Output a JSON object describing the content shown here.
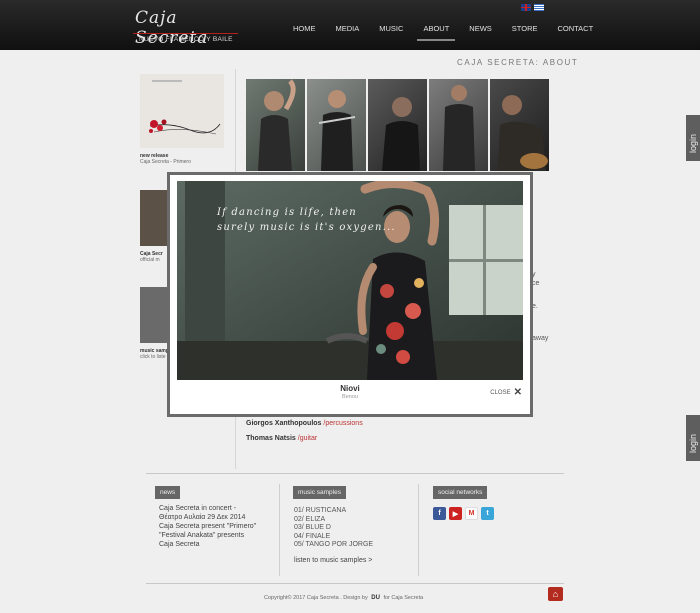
{
  "header": {
    "logo_text": "Caja Secreta",
    "logo_tagline": "NUEVO FLAMENCO Y BAILE",
    "nav": [
      {
        "label": "HOME"
      },
      {
        "label": "MEDIA"
      },
      {
        "label": "MUSIC"
      },
      {
        "label": "ABOUT"
      },
      {
        "label": "NEWS"
      },
      {
        "label": "STORE"
      },
      {
        "label": "CONTACT"
      }
    ]
  },
  "page_heading": "CAJA SECRETA: ABOUT",
  "sidebar": {
    "cards": [
      {
        "title": "new release",
        "subtitle": "Caja Secreta - Primero"
      },
      {
        "title": "Caja Secr",
        "subtitle": "official m"
      },
      {
        "title": "music samp",
        "subtitle": "click to liste"
      }
    ]
  },
  "body_fragments": {
    "f1": "y",
    "f2": "ce",
    "f3": "e.",
    "f4": "away"
  },
  "members": [
    {
      "name": "Giorgos Xanthopoulos",
      "role": "/percussions"
    },
    {
      "name": "Thomas Natsis",
      "role": "/guitar"
    }
  ],
  "modal": {
    "quote_line1": "If dancing is life, then",
    "quote_line2": "surely music is it's oxygen...",
    "caption_name": "Niovi",
    "caption_sub": "Benou",
    "close_label": "CLOSE",
    "close_icon": "close-icon"
  },
  "login_label": "login",
  "footer": {
    "news_label": "news",
    "news_items": [
      "Caja Secreta in concert -",
      "Θέατρο Αυλαία 29 Δεκ 2014",
      "Caja Secreta present \"Primero\"",
      "\"Festival Anakata\" presents",
      "Caja Secreta"
    ],
    "samples_label": "music samples",
    "samples": [
      "01/ RUSTICANA",
      "02/ ELIZA",
      "03/ BLUE D",
      "04/ FINALE",
      "05/ TANGO POR JORGE"
    ],
    "listen_link": "listen to music samples >",
    "social_label": "social networks",
    "social": [
      {
        "name": "facebook-icon",
        "glyph": "f",
        "color": "#3b5998"
      },
      {
        "name": "youtube-icon",
        "glyph": "▶",
        "color": "#cc2222"
      },
      {
        "name": "gmail-icon",
        "glyph": "M",
        "color": "#d93025"
      },
      {
        "name": "twitter-icon",
        "glyph": "t",
        "color": "#3aa5d8"
      }
    ],
    "copyright": "Copyright© 2017 Caja Secreta . Design by",
    "copyright_logo": "DU",
    "copyright_tail": "for Caja Secreta",
    "top_icon": "home-top-icon"
  }
}
